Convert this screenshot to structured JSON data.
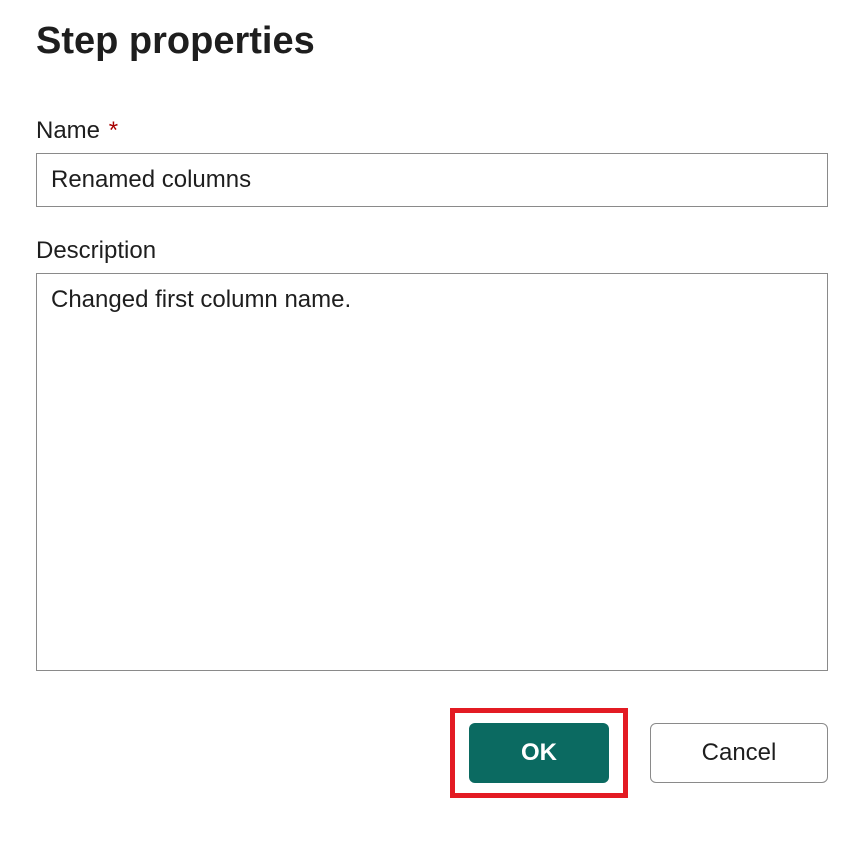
{
  "dialog": {
    "title": "Step properties",
    "fields": {
      "name": {
        "label": "Name",
        "required_marker": "*",
        "value": "Renamed columns"
      },
      "description": {
        "label": "Description",
        "value": "Changed first column name."
      }
    },
    "buttons": {
      "ok": "OK",
      "cancel": "Cancel"
    }
  }
}
